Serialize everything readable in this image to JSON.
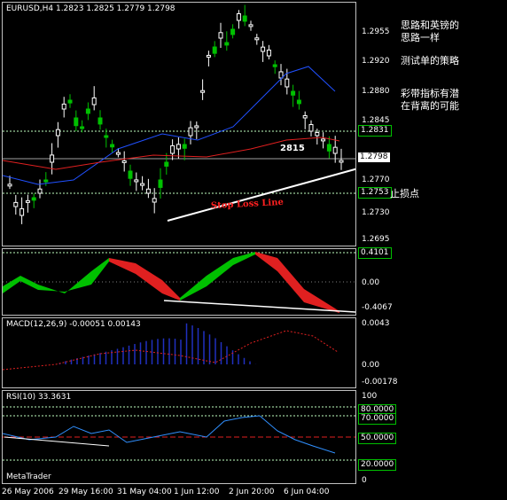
{
  "main": {
    "title": "EURUSD,H4  1.2823 1.2825 1.2779 1.2798",
    "price_labels": [
      "1.2955",
      "1.2920",
      "1.2880",
      "1.2845",
      "1.2770",
      "1.2730",
      "1.2695"
    ],
    "current_price": "1.2798",
    "level_upper": "1.2831",
    "level_lower": "1.2753",
    "annotation_number": "2815",
    "stop_loss_label": "Stop Loss Line",
    "stop_point_label": "止损点"
  },
  "osc": {
    "labels": [
      "0.4101",
      "0.00",
      "-0.4067"
    ]
  },
  "macd": {
    "title": "MACD(12,26,9) -0.00051 0.00143",
    "labels": [
      "0.0043",
      "0.00",
      "-0.00178"
    ]
  },
  "rsi": {
    "title": "RSI(10) 33.3631",
    "labels": [
      "100",
      "80.0000",
      "70.0000",
      "50.0000",
      "20.0000",
      "0"
    ],
    "watermark": "MetaTrader"
  },
  "time_axis": [
    "26 May 2006",
    "29 May 16:00",
    "31 May 04:00",
    "1 Jun 12:00",
    "2 Jun 20:00",
    "6 Jun 04:00"
  ],
  "notes": {
    "line1": "思路和英镑的",
    "line2": "思路一样",
    "line3": "测试单的策略",
    "line4": "彩带指标有潜",
    "line5": "在背离的可能"
  },
  "colors": {
    "bull": "#00c000",
    "bear": "#ffffff",
    "ma_blue": "#2050ff",
    "ma_red": "#e02020",
    "stop_red": "#ff2020"
  }
}
